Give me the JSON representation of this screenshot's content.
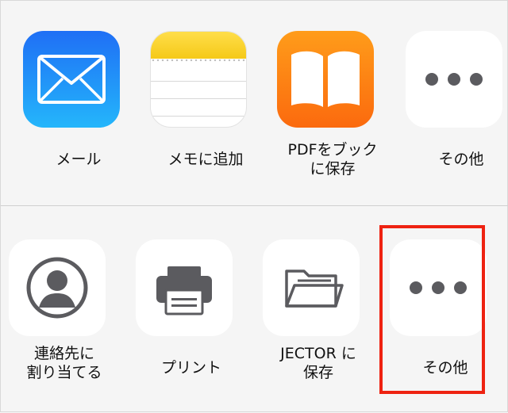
{
  "share_sheet": {
    "apps": [
      {
        "label": "メール",
        "icon": "mail-icon"
      },
      {
        "label": "メモに追加",
        "icon": "notes-icon"
      },
      {
        "label": "PDFをブック\nに保存",
        "icon": "books-icon"
      },
      {
        "label": "その他",
        "icon": "more-icon"
      }
    ],
    "actions": [
      {
        "label": "連絡先に\n割り当てる",
        "icon": "contact-icon"
      },
      {
        "label": "プリント",
        "icon": "printer-icon"
      },
      {
        "label": "JECTOR に\n保存",
        "icon": "folder-icon"
      },
      {
        "label": "その他",
        "icon": "more-icon"
      }
    ]
  },
  "colors": {
    "mail": "#1f8ff7",
    "notes_header": "#fbd232",
    "books": "#fb7f14",
    "glyph_gray": "#5b5b5f",
    "highlight": "#ee2211"
  }
}
